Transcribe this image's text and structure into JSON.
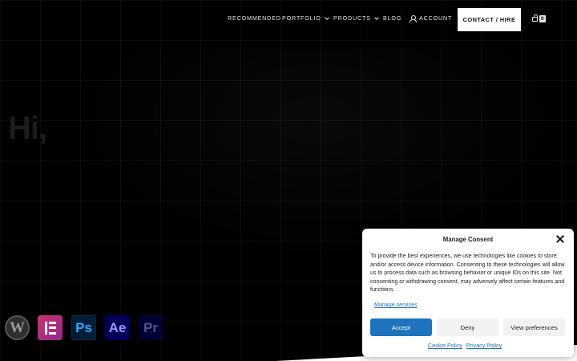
{
  "nav": {
    "items": [
      {
        "label": "RECOMMENDED"
      },
      {
        "label": "PORTFOLIO"
      },
      {
        "label": "PRODUCTS"
      },
      {
        "label": "BLOG"
      },
      {
        "label": "ACCOUNT"
      }
    ],
    "contact_label": "CONTACT / HIRE",
    "cart_count": "0"
  },
  "hero": {
    "title": "Hi,"
  },
  "tools": {
    "wordpress": "W",
    "photoshop": "Ps",
    "after_effects": "Ae",
    "premiere": "Pr"
  },
  "consent": {
    "title": "Manage Consent",
    "body": "To provide the best experiences, we use technologies like cookies to store and/or access device information. Consenting to these technologies will allow us to process data such as browsing behavior or unique IDs on this site. Not consenting or withdrawing consent, may adversely affect certain features and functions.",
    "manage_services": "Manage services",
    "accept": "Accept",
    "deny": "Deny",
    "view_preferences": "View preferences",
    "cookie_policy": "Cookie Policy",
    "privacy_policy": "Privacy Policy"
  },
  "colors": {
    "background": "#000000",
    "accent": "#1e73be",
    "elementor": "#d0306c",
    "photoshop_bg": "#001e36",
    "adobe_bg": "#00005b"
  }
}
